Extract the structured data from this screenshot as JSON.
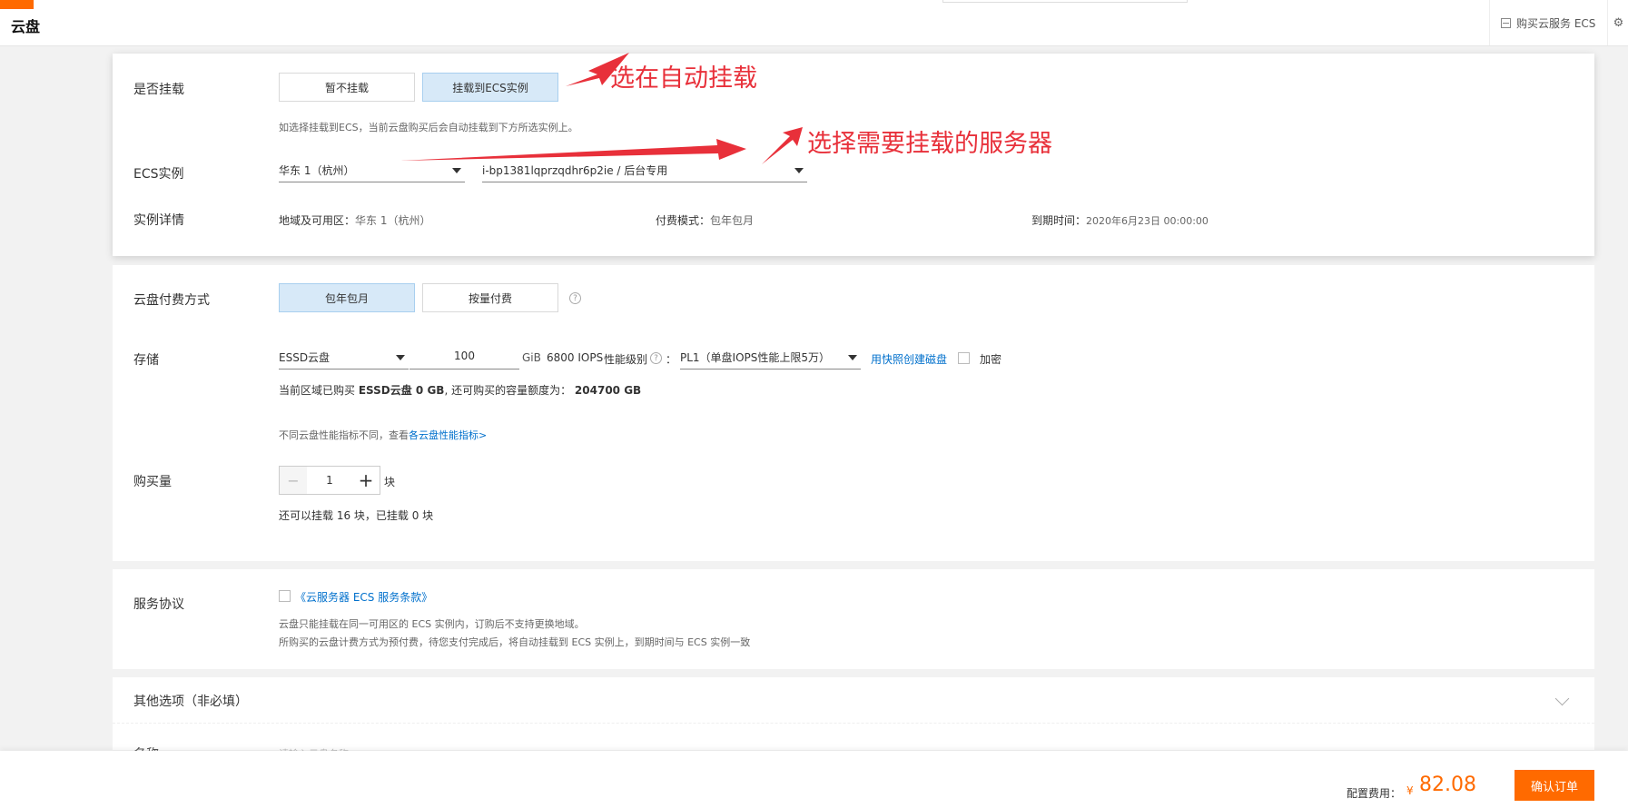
{
  "header": {
    "title": "云盘",
    "buy_ecs": "购买云服务 ECS",
    "gear_icon": "gear-icon"
  },
  "mount": {
    "label": "是否挂载",
    "opt_no": "暂不挂载",
    "opt_yes": "挂载到ECS实例",
    "selected": "挂载到ECS实例",
    "hint": "如选择挂载到ECS，当前云盘购买后会自动挂载到下方所选实例上。",
    "ecs_label": "ECS实例",
    "region_value": "华东 1（杭州）",
    "instance_value": "i-bp1381lqprzqdhr6p2ie / 后台专用",
    "detail_label": "实例详情",
    "region_key": "地域及可用区：",
    "region_val": "华东 1（杭州）",
    "pay_key": "付费模式：",
    "pay_val": "包年包月",
    "expire_key": "到期时间：",
    "expire_val": "2020年6月23日 00:00:00"
  },
  "annotations": {
    "a1": "选在自动挂载",
    "a2": "选择需要挂载的服务器",
    "color": "#e8303a"
  },
  "billing": {
    "label": "云盘付费方式",
    "opt1": "包年包月",
    "opt2": "按量付费",
    "selected": "包年包月",
    "help": "?"
  },
  "storage": {
    "label": "存储",
    "type": "ESSD云盘",
    "size": "100",
    "unit": "GiB",
    "iops": "6800 IOPS",
    "perf_label": "性能级别",
    "help": "?",
    "colon": "：",
    "perf_value": "PL1（单盘IOPS性能上限5万）",
    "snapshot_link": "用快照创建磁盘",
    "encrypt": "加密",
    "quota_a": "当前区域已购买",
    "quota_b": "ESSD云盘 0 GB",
    "quota_c": ", 还可购买的容量额度为：",
    "quota_d": "204700 GB",
    "perf_hint": "不同云盘性能指标不同，查看",
    "perf_link": "各云盘性能指标>"
  },
  "quantity": {
    "label": "购买量",
    "minus": "−",
    "value": "1",
    "plus": "+",
    "unit": "块",
    "remain": "还可以挂载 16 块，已挂载 0 块"
  },
  "agreement": {
    "label": "服务协议",
    "link": "《云服务器 ECS 服务条款》",
    "line1": "云盘只能挂载在同一可用区的 ECS 实例内，订购后不支持更换地域。",
    "line2": "所购买的云盘计费方式为预付费，待您支付完成后，将自动挂载到 ECS 实例上，到期时间与 ECS 实例一致"
  },
  "other": {
    "label": "其他选项（非必填）",
    "name_label": "名称",
    "name_placeholder": "请输入云盘名称"
  },
  "footer": {
    "cost_label": "配置费用：",
    "currency": "¥",
    "cost": "82.08",
    "confirm": "确认订单",
    "accent": "#ff6a00"
  }
}
